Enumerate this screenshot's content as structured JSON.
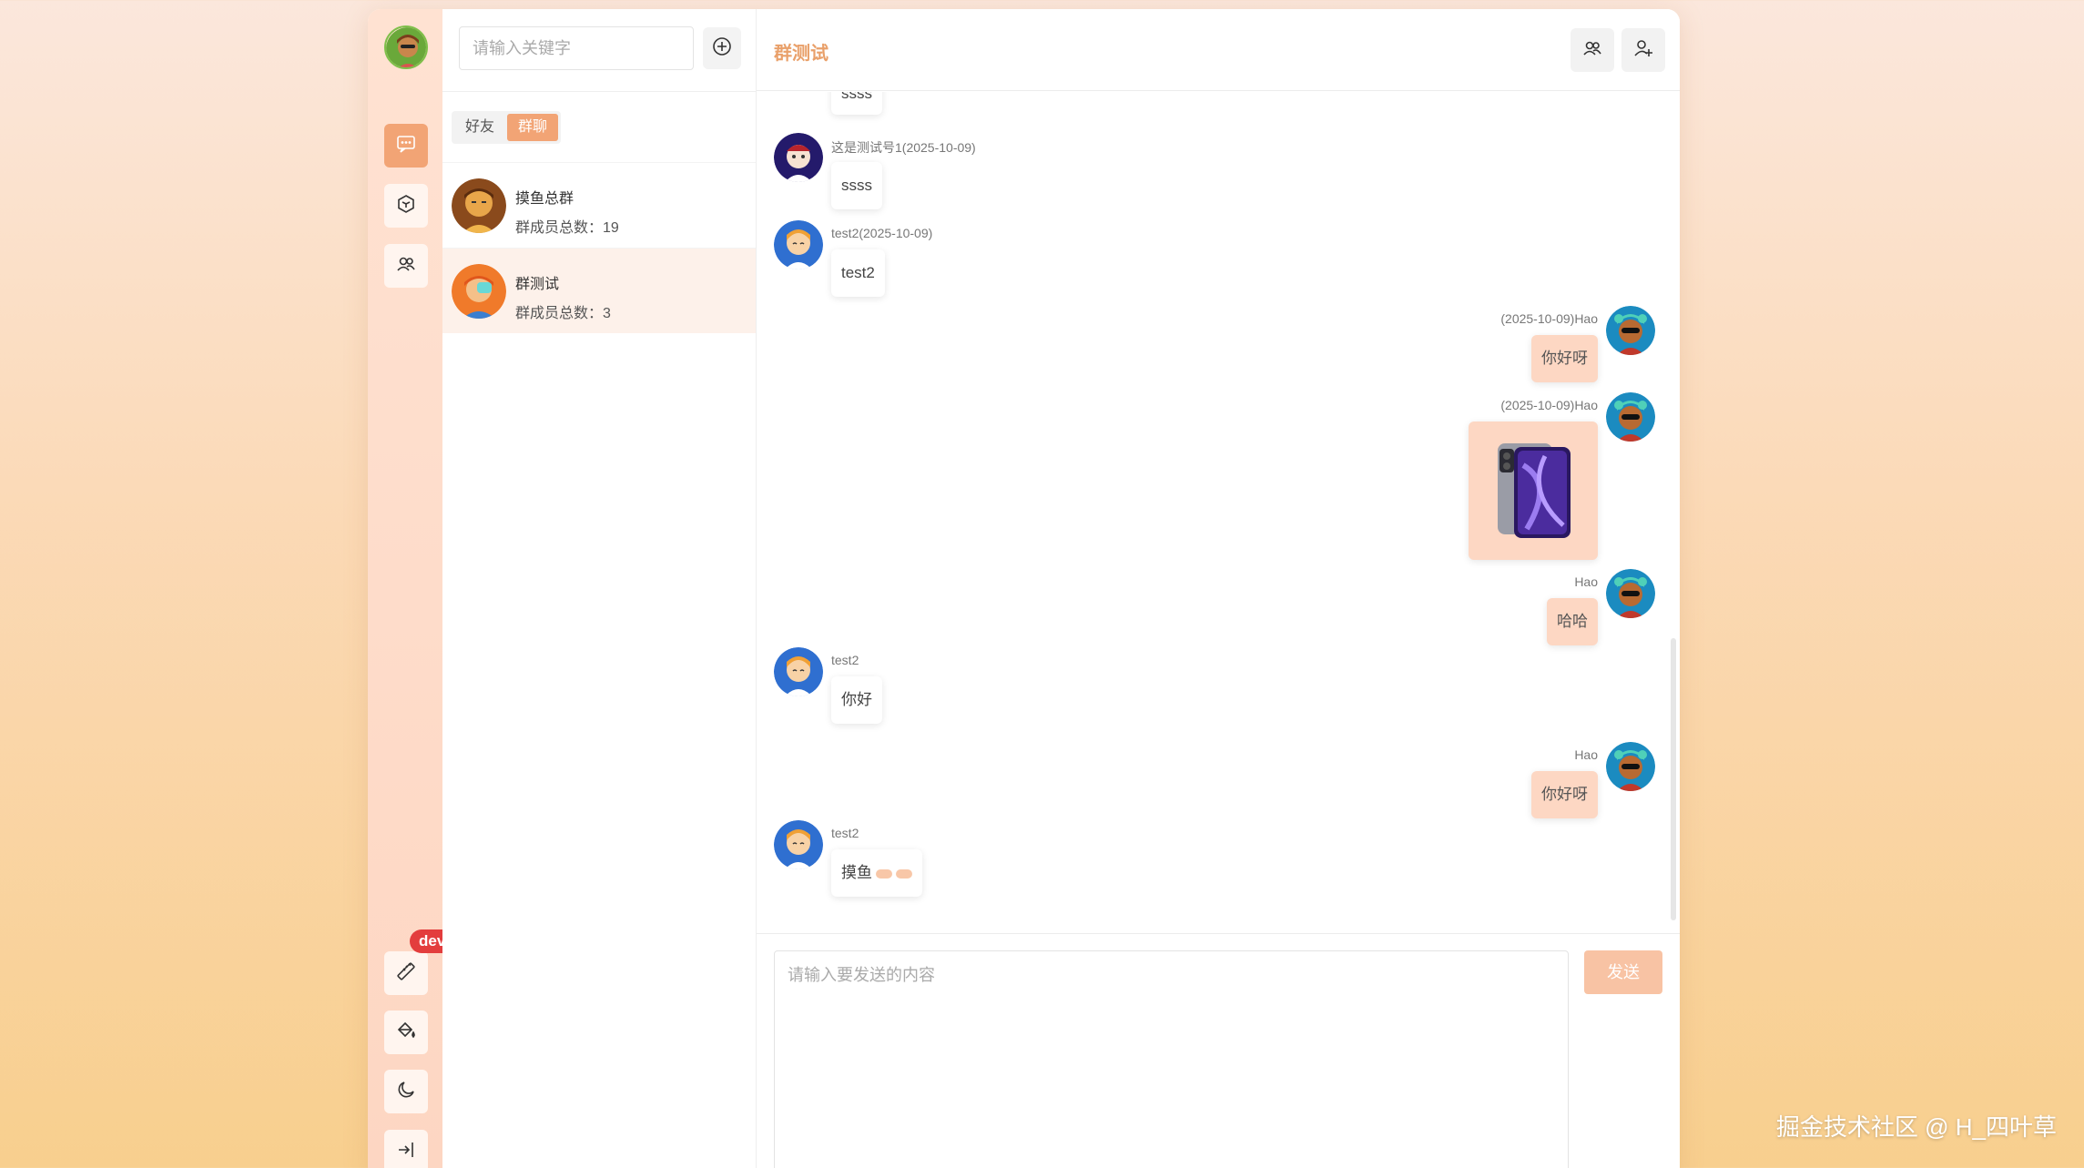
{
  "contacts": {
    "search_placeholder": "请输入关键字",
    "tabs": [
      "好友",
      "群聊"
    ],
    "active_tab": "群聊",
    "groups": [
      {
        "name": "摸鱼总群",
        "count_text": "群成员总数：19"
      },
      {
        "name": "群测试",
        "count_text": "群成员总数：3"
      }
    ]
  },
  "rail": {
    "badge": "dev",
    "icons": [
      "chat-icon",
      "hexagon-icon",
      "group-icon",
      "ruler-icon",
      "paint-bucket-icon",
      "moon-icon",
      "logout-icon"
    ]
  },
  "chat": {
    "title": "群测试",
    "messages": [
      {
        "side": "left",
        "meta": "",
        "text": "ssss"
      },
      {
        "side": "left",
        "meta": "这是测试号1(2025-10-09)",
        "text": "ssss"
      },
      {
        "side": "left",
        "meta": "test2(2025-10-09)",
        "text": "test2"
      },
      {
        "side": "right",
        "meta": "(2025-10-09)Hao",
        "text": "你好呀"
      },
      {
        "side": "right",
        "meta": "(2025-10-09)Hao",
        "text": "",
        "image": "phone-image"
      },
      {
        "side": "right",
        "meta": "Hao",
        "text": "哈哈"
      },
      {
        "side": "left",
        "meta": "test2",
        "text": "你好"
      },
      {
        "side": "right",
        "meta": "Hao",
        "text": "你好呀"
      },
      {
        "side": "left",
        "meta": "test2",
        "text": "摸鱼"
      }
    ]
  },
  "composer": {
    "placeholder": "请输入要发送的内容",
    "send_label": "发送"
  },
  "watermark": "掘金技术社区 @ H_四叶草",
  "colors": {
    "accent": "#f2a475",
    "title": "#e9a06a",
    "own_bubble": "#fdd7c3",
    "badge": "#e33d3d"
  }
}
